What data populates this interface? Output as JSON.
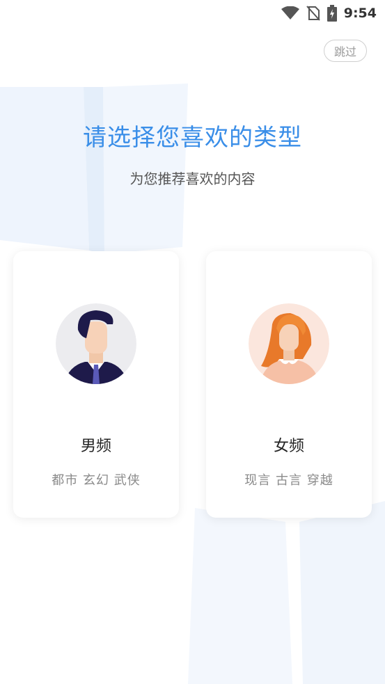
{
  "status_bar": {
    "time": "9:54",
    "icons": [
      "wifi-icon",
      "no-sim-icon",
      "battery-charging-icon"
    ]
  },
  "header": {
    "skip_label": "跳过"
  },
  "main": {
    "title": "请选择您喜欢的类型",
    "subtitle": "为您推荐喜欢的内容"
  },
  "options": [
    {
      "label": "男频",
      "tags": "都市 玄幻 武侠",
      "avatar": "male-avatar-icon"
    },
    {
      "label": "女频",
      "tags": "现言 古言 穿越",
      "avatar": "female-avatar-icon"
    }
  ],
  "colors": {
    "accent": "#3a8ee8",
    "background_book": "#eef4fc"
  }
}
